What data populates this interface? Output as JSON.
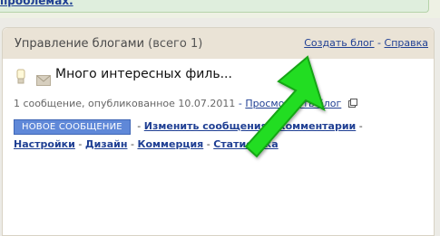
{
  "top": {
    "alert_link": "проблемах."
  },
  "panel": {
    "title": "Управление блогами",
    "count": "(всего 1)",
    "create_blog": "Создать блог",
    "separator": "-",
    "help": "Справка"
  },
  "blog": {
    "title": "Много интересных филь...",
    "meta_prefix": "1 сообщение, опубликованное 10.07.2011",
    "view_blog": "Просмотреть блог",
    "actions_row1": {
      "new_post": "НОВОЕ СООБЩЕНИЕ",
      "edit_posts": "Изменить сообщения",
      "comments": "Комментарии"
    },
    "actions_row2": {
      "settings": "Настройки",
      "design": "Дизайн",
      "monetize": "Коммерция",
      "stats": "Статистика"
    }
  },
  "colors": {
    "accent": "#1f3f93",
    "button": "#5f88d8",
    "arrow": "#22dd22"
  },
  "icons": {
    "lamp": "lamp-icon",
    "mail": "mail-icon",
    "external": "external-link-icon",
    "arrow": "green-arrow-icon"
  }
}
